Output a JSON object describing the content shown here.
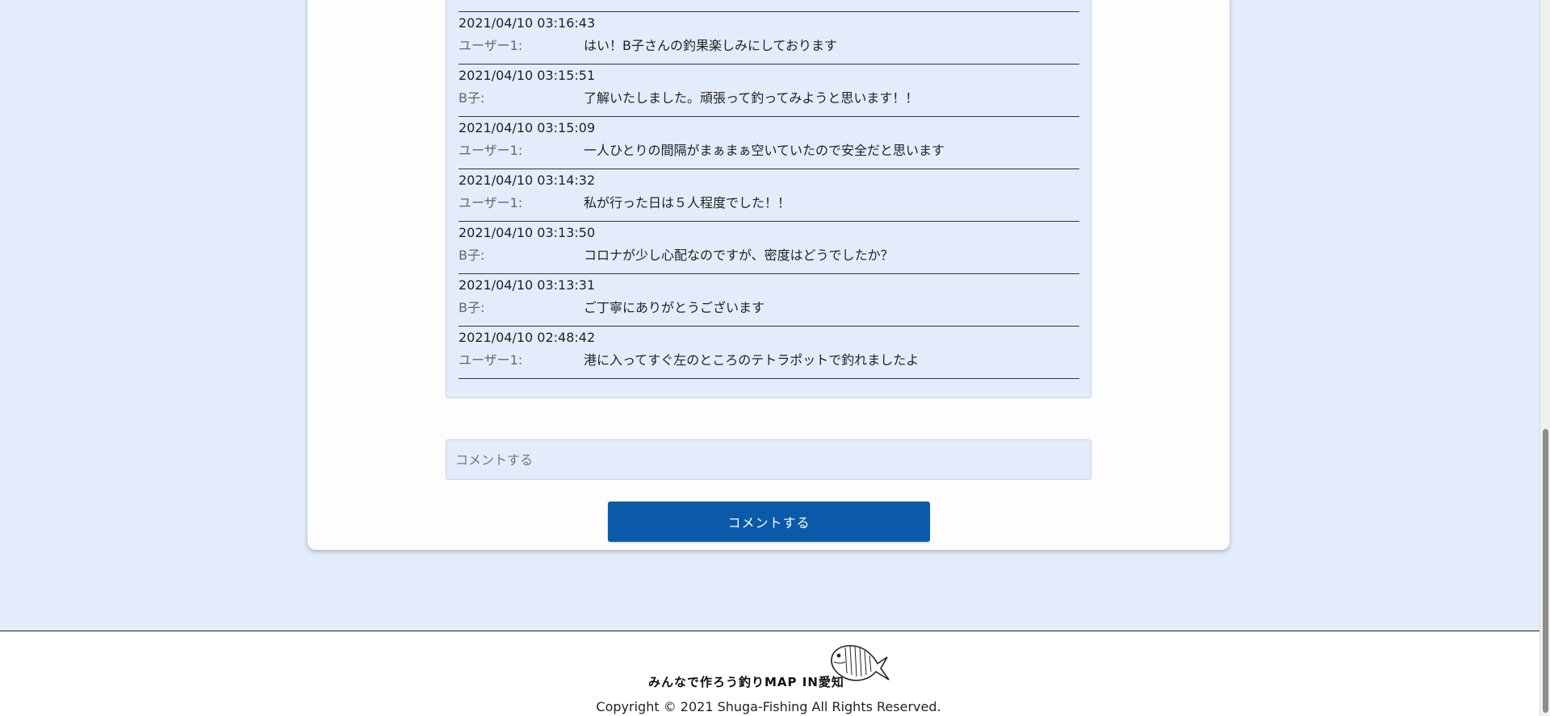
{
  "comments": [
    {
      "timestamp": "2021/04/10 03:16:43",
      "user": "ユーザー1:",
      "message": "はい！B子さんの釣果楽しみにしております"
    },
    {
      "timestamp": "2021/04/10 03:15:51",
      "user": "B子:",
      "message": "了解いたしました。頑張って釣ってみようと思います！！"
    },
    {
      "timestamp": "2021/04/10 03:15:09",
      "user": "ユーザー1:",
      "message": "一人ひとりの間隔がまぁまぁ空いていたので安全だと思います"
    },
    {
      "timestamp": "2021/04/10 03:14:32",
      "user": "ユーザー1:",
      "message": "私が行った日は５人程度でした！！"
    },
    {
      "timestamp": "2021/04/10 03:13:50",
      "user": "B子:",
      "message": "コロナが少し心配なのですが、密度はどうでしたか？"
    },
    {
      "timestamp": "2021/04/10 03:13:31",
      "user": "B子:",
      "message": "ご丁寧にありがとうございます"
    },
    {
      "timestamp": "2021/04/10 02:48:42",
      "user": "ユーザー1:",
      "message": "港に入ってすぐ左のところのテトラポットで釣れましたよ"
    }
  ],
  "comment_form": {
    "placeholder": "コメントする",
    "value": "",
    "submit_label": "コメントする"
  },
  "footer": {
    "logo_text": "みんなで作ろう釣りMAP IN愛知",
    "logo_icon": "fish-icon",
    "copyright": "Copyright © 2021 Shuga-Fishing All Rights Reserved."
  },
  "colors": {
    "page_background": "#e3ecfb",
    "card_background": "#fdfdfe",
    "button": "#0b5aa9",
    "button_text": "#ffffff"
  }
}
